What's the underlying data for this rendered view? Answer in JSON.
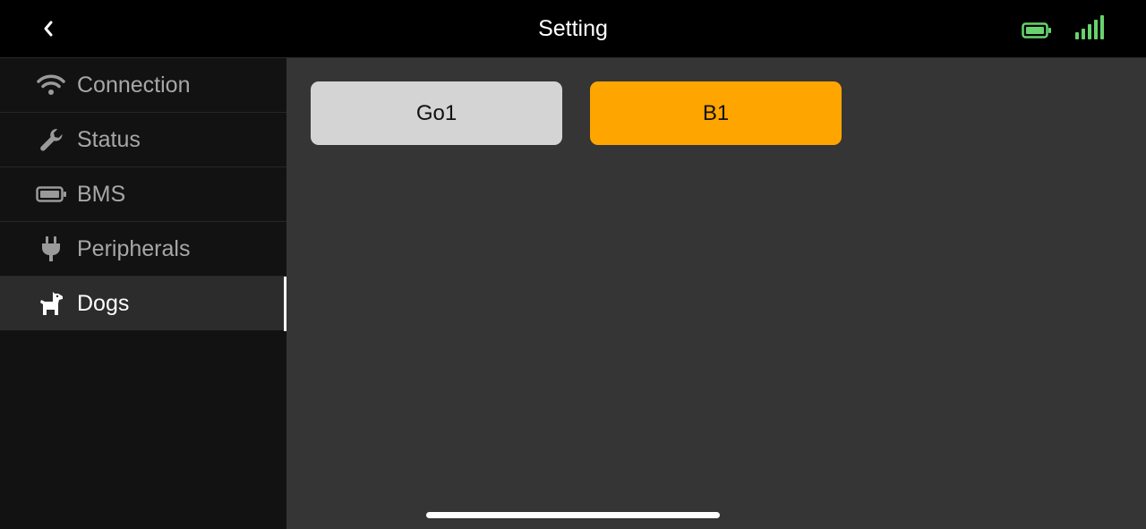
{
  "header": {
    "title": "Setting"
  },
  "status": {
    "battery_icon": "battery-icon",
    "signal_icon": "signal-icon",
    "status_color": "#66d36e"
  },
  "sidebar": {
    "items": [
      {
        "label": "Connection",
        "icon": "wifi-icon"
      },
      {
        "label": "Status",
        "icon": "wrench-icon"
      },
      {
        "label": "BMS",
        "icon": "battery-icon"
      },
      {
        "label": "Peripherals",
        "icon": "plug-icon"
      },
      {
        "label": "Dogs",
        "icon": "dog-icon",
        "active": true
      }
    ]
  },
  "main": {
    "buttons": [
      {
        "label": "Go1",
        "color": "#d4d4d4"
      },
      {
        "label": "B1",
        "color": "#ffa500",
        "selected": true
      }
    ]
  }
}
